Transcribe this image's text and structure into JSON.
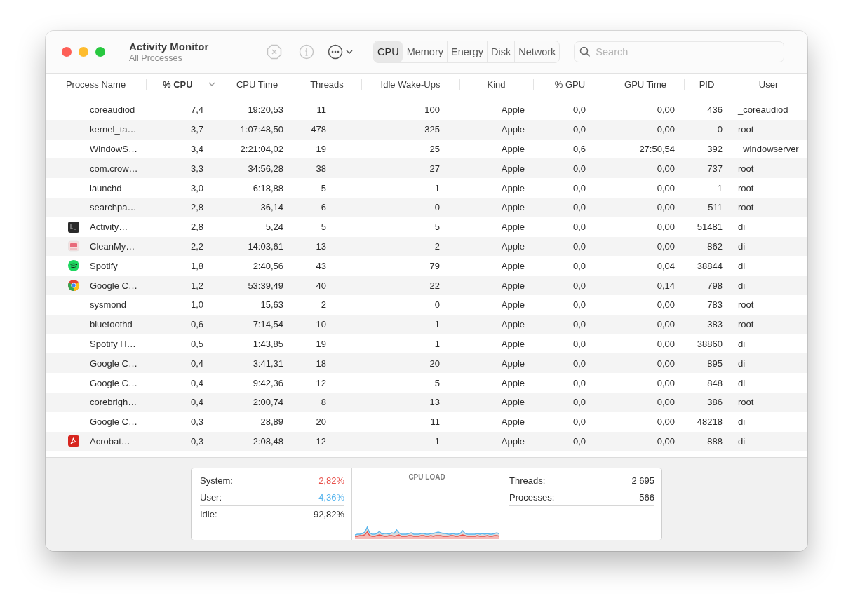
{
  "window": {
    "title": "Activity Monitor",
    "subtitle": "All Processes"
  },
  "tabs": [
    {
      "label": "CPU",
      "selected": true
    },
    {
      "label": "Memory",
      "selected": false
    },
    {
      "label": "Energy",
      "selected": false
    },
    {
      "label": "Disk",
      "selected": false
    },
    {
      "label": "Network",
      "selected": false
    }
  ],
  "search": {
    "placeholder": "Search"
  },
  "table": {
    "columns": [
      {
        "label": "Process Name",
        "sorted": false
      },
      {
        "label": "% CPU",
        "sorted": true
      },
      {
        "label": "CPU Time",
        "sorted": false
      },
      {
        "label": "Threads",
        "sorted": false
      },
      {
        "label": "Idle Wake-Ups",
        "sorted": false
      },
      {
        "label": "Kind",
        "sorted": false
      },
      {
        "label": "% GPU",
        "sorted": false
      },
      {
        "label": "GPU Time",
        "sorted": false
      },
      {
        "label": "PID",
        "sorted": false
      },
      {
        "label": "User",
        "sorted": false
      }
    ],
    "rows": [
      {
        "kind": "plain",
        "cells": [
          "coreaudiod",
          "7,4",
          "19:20,53",
          "11",
          "100",
          "Apple",
          "0,0",
          "0,00",
          "436",
          "_coreaudiod"
        ]
      },
      {
        "kind": "plain",
        "cells": [
          "kernel_ta…",
          "3,7",
          "1:07:48,50",
          "478",
          "325",
          "Apple",
          "0,0",
          "0,00",
          "0",
          "root"
        ]
      },
      {
        "kind": "plain",
        "cells": [
          "WindowS…",
          "3,4",
          "2:21:04,02",
          "19",
          "25",
          "Apple",
          "0,6",
          "27:50,54",
          "392",
          "_windowserver"
        ]
      },
      {
        "kind": "plain",
        "cells": [
          "com.crow…",
          "3,3",
          "34:56,28",
          "38",
          "27",
          "Apple",
          "0,0",
          "0,00",
          "737",
          "root"
        ]
      },
      {
        "kind": "plain",
        "cells": [
          "launchd",
          "3,0",
          "6:18,88",
          "5",
          "1",
          "Apple",
          "0,0",
          "0,00",
          "1",
          "root"
        ]
      },
      {
        "kind": "plain",
        "cells": [
          "searchpa…",
          "2,8",
          "36,14",
          "6",
          "0",
          "Apple",
          "0,0",
          "0,00",
          "511",
          "root"
        ]
      },
      {
        "kind": "terminal",
        "cells": [
          "Activity…",
          "2,8",
          "5,24",
          "5",
          "5",
          "Apple",
          "0,0",
          "0,00",
          "51481",
          "di"
        ]
      },
      {
        "kind": "cleaner",
        "cells": [
          "CleanMy…",
          "2,2",
          "14:03,61",
          "13",
          "2",
          "Apple",
          "0,0",
          "0,00",
          "862",
          "di"
        ]
      },
      {
        "kind": "spotify",
        "cells": [
          "Spotify",
          "1,8",
          "2:40,56",
          "43",
          "79",
          "Apple",
          "0,0",
          "0,04",
          "38844",
          "di"
        ]
      },
      {
        "kind": "chrome",
        "cells": [
          "Google C…",
          "1,2",
          "53:39,49",
          "40",
          "22",
          "Apple",
          "0,0",
          "0,14",
          "798",
          "di"
        ]
      },
      {
        "kind": "plain",
        "cells": [
          "sysmond",
          "1,0",
          "15,63",
          "2",
          "0",
          "Apple",
          "0,0",
          "0,00",
          "783",
          "root"
        ]
      },
      {
        "kind": "plain",
        "cells": [
          "bluetoothd",
          "0,6",
          "7:14,54",
          "10",
          "1",
          "Apple",
          "0,0",
          "0,00",
          "383",
          "root"
        ]
      },
      {
        "kind": "plain",
        "cells": [
          "Spotify H…",
          "0,5",
          "1:43,85",
          "19",
          "1",
          "Apple",
          "0,0",
          "0,00",
          "38860",
          "di"
        ]
      },
      {
        "kind": "plain",
        "cells": [
          "Google C…",
          "0,4",
          "3:41,31",
          "18",
          "20",
          "Apple",
          "0,0",
          "0,00",
          "895",
          "di"
        ]
      },
      {
        "kind": "plain",
        "cells": [
          "Google C…",
          "0,4",
          "9:42,36",
          "12",
          "5",
          "Apple",
          "0,0",
          "0,00",
          "848",
          "di"
        ]
      },
      {
        "kind": "plain",
        "cells": [
          "corebrigh…",
          "0,4",
          "2:00,74",
          "8",
          "13",
          "Apple",
          "0,0",
          "0,00",
          "386",
          "root"
        ]
      },
      {
        "kind": "plain",
        "cells": [
          "Google C…",
          "0,3",
          "28,89",
          "20",
          "11",
          "Apple",
          "0,0",
          "0,00",
          "48218",
          "di"
        ]
      },
      {
        "kind": "acrobat",
        "cells": [
          "Acrobat…",
          "0,3",
          "2:08,48",
          "12",
          "1",
          "Apple",
          "0,0",
          "0,00",
          "888",
          "di"
        ]
      }
    ]
  },
  "cpu_stats": [
    {
      "label": "System:",
      "value": "2,82%",
      "color": "#e8504a"
    },
    {
      "label": "User:",
      "value": "4,36%",
      "color": "#5ab6ee"
    },
    {
      "label": "Idle:",
      "value": "92,82%",
      "color": "#2b2b2b"
    }
  ],
  "cpu_load": {
    "title": "CPU LOAD"
  },
  "counts": [
    {
      "label": "Threads:",
      "value": "2 695"
    },
    {
      "label": "Processes:",
      "value": "566"
    }
  ]
}
